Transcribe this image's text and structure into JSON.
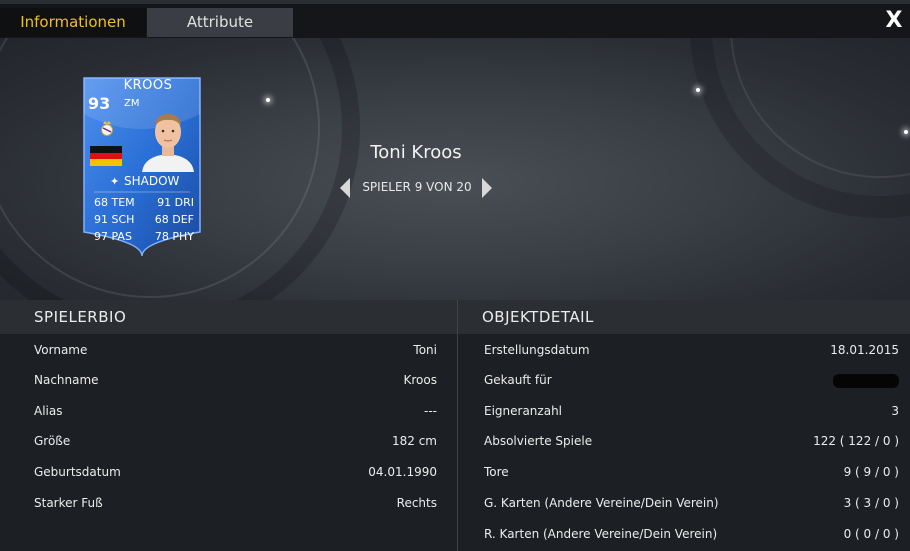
{
  "tabs": [
    {
      "label": "Informationen",
      "active": true
    },
    {
      "label": "Attribute",
      "active": false
    }
  ],
  "close_label": "X",
  "card": {
    "name": "KROOS",
    "rating": "93",
    "position": "ZM",
    "chemistry_style": "SHADOW",
    "stats": [
      [
        "68 TEM",
        "91 DRI"
      ],
      [
        "91 SCH",
        "68 DEF"
      ],
      [
        "97 PAS",
        "78 PHY"
      ]
    ],
    "colors": {
      "card_blue": "#2a6fd6",
      "card_dark": "#1a4aa0",
      "flag": [
        "#111111",
        "#dd1111",
        "#f5c400"
      ]
    }
  },
  "player": {
    "name": "Toni Kroos",
    "pager_label": "SPIELER 9 VON 20"
  },
  "bio": {
    "title": "SPIELERBIO",
    "rows": [
      {
        "key": "Vorname",
        "value": "Toni"
      },
      {
        "key": "Nachname",
        "value": "Kroos"
      },
      {
        "key": "Alias",
        "value": "---"
      },
      {
        "key": "Größe",
        "value": "182 cm"
      },
      {
        "key": "Geburtsdatum",
        "value": "04.01.1990"
      },
      {
        "key": "Starker Fuß",
        "value": "Rechts"
      }
    ]
  },
  "item": {
    "title": "OBJEKTDETAIL",
    "rows": [
      {
        "key": "Erstellungsdatum",
        "value": "18.01.2015"
      },
      {
        "key": "Gekauft für",
        "value": ""
      },
      {
        "key": "Eigneranzahl",
        "value": "3"
      },
      {
        "key": "Absolvierte Spiele",
        "value": "122 ( 122 / 0 )"
      },
      {
        "key": "Tore",
        "value": "9 ( 9 / 0 )"
      },
      {
        "key": "G. Karten (Andere Vereine/Dein Verein)",
        "value": "3 ( 3 / 0 )"
      },
      {
        "key": "R. Karten (Andere Vereine/Dein Verein)",
        "value": "0 ( 0 / 0 )"
      }
    ]
  },
  "accent_color": "#f0c020"
}
